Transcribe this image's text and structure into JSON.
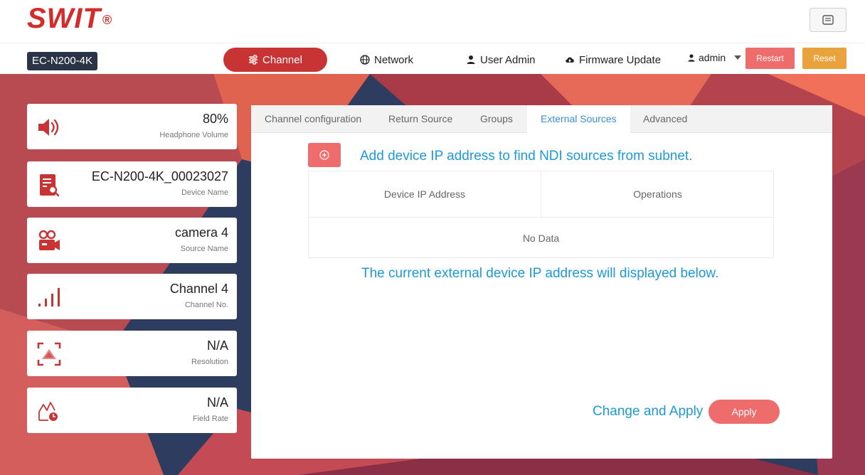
{
  "brand": {
    "name": "SWIT",
    "mark": "®",
    "color": "#d42b2b"
  },
  "header": {
    "message_icon": "message-icon"
  },
  "navbar": {
    "model": "EC-N200-4K",
    "items": [
      {
        "label": "Channel",
        "icon": "sliders-icon",
        "active": true
      },
      {
        "label": "Network",
        "icon": "globe-icon",
        "active": false
      },
      {
        "label": "User Admin",
        "icon": "user-icon",
        "active": false
      },
      {
        "label": "Firmware Update",
        "icon": "cloud-upload-icon",
        "active": false
      }
    ],
    "user": "admin",
    "restart_label": "Restart",
    "reset_label": "Reset"
  },
  "cards": [
    {
      "value": "80%",
      "label": "Headphone Volume",
      "icon": "speaker-icon"
    },
    {
      "value": "EC-N200-4K_00023027",
      "label": "Device Name",
      "icon": "device-search-icon"
    },
    {
      "value": "camera 4",
      "label": "Source Name",
      "icon": "video-camera-icon"
    },
    {
      "value": "Channel 4",
      "label": "Channel No.",
      "icon": "signal-bars-icon"
    },
    {
      "value": "N/A",
      "label": "Resolution",
      "icon": "resolution-icon"
    },
    {
      "value": "N/A",
      "label": "Field Rate",
      "icon": "field-rate-icon"
    }
  ],
  "tabs": [
    {
      "label": "Channel configuration",
      "active": false
    },
    {
      "label": "Return Source",
      "active": false
    },
    {
      "label": "Groups",
      "active": false
    },
    {
      "label": "External Sources",
      "active": true
    },
    {
      "label": "Advanced",
      "active": false
    }
  ],
  "external": {
    "add_hint": "Add device IP address to find NDI sources from subnet.",
    "columns": [
      "Device IP Address",
      "Operations"
    ],
    "empty_text": "No Data",
    "below_hint": "The current external device IP address will displayed below.",
    "apply_caption": "Change and Apply",
    "apply_label": "Apply"
  },
  "colors": {
    "accent_red": "#c83434",
    "button_red": "#ef6c6c",
    "button_orange": "#eaa33c",
    "hint_blue": "#1d9ad6",
    "navy": "#2b3447"
  }
}
